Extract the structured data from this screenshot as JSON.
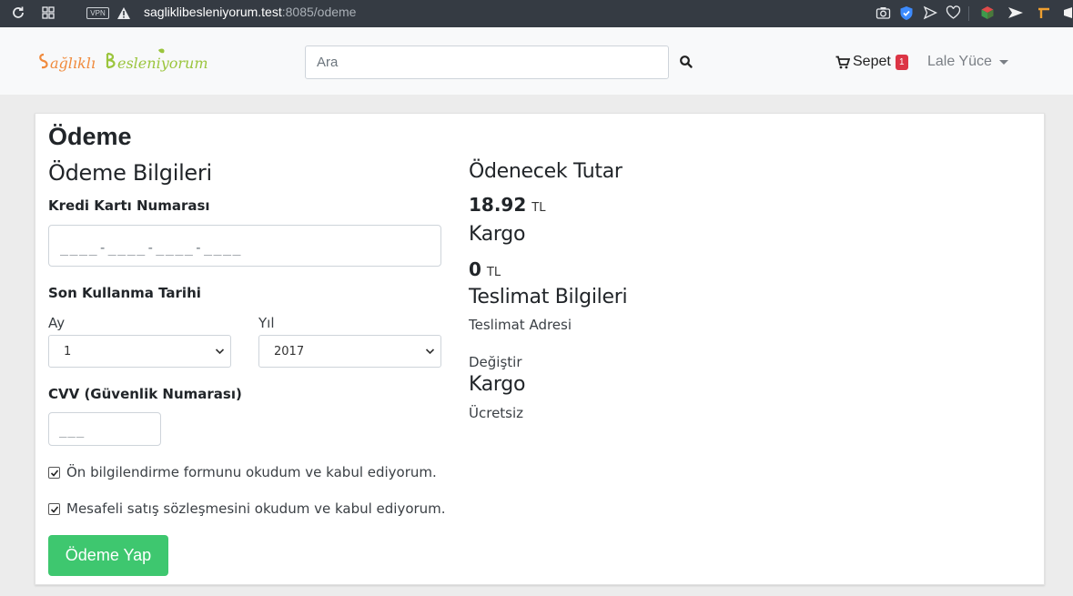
{
  "browser": {
    "url_host": "sagliklibesleniyorum.test",
    "url_path": ":8085/odeme",
    "vpn_label": "VPN"
  },
  "navbar": {
    "logo_text": "Sağlıklı Besleniyorum",
    "search_placeholder": "Ara",
    "cart_label": "Sepet",
    "cart_count": "1",
    "user_name": "Lale Yüce"
  },
  "page": {
    "title": "Ödeme",
    "payment_info_heading": "Ödeme Bilgileri",
    "card_number_label": "Kredi Kartı Numarası",
    "card_number_placeholder": "____-____-____-____",
    "expiry_label": "Son Kullanma Tarihi",
    "month_label": "Ay",
    "month_value": "1",
    "year_label": "Yıl",
    "year_value": "2017",
    "cvv_label": "CVV (Güvenlik Numarası)",
    "cvv_placeholder": "___",
    "checkbox_1": "Ön bilgilendirme formunu okudum ve kabul ediyorum.",
    "checkbox_2": "Mesafeli satış sözleşmesini okudum ve kabul ediyorum.",
    "pay_button": "Ödeme Yap"
  },
  "summary": {
    "amount_heading": "Ödenecek Tutar",
    "amount_value": "18.92",
    "currency": "TL",
    "shipping_heading": "Kargo",
    "shipping_value": "0",
    "delivery_heading": "Teslimat Bilgileri",
    "delivery_address": "Teslimat Adresi",
    "change_link": "Değiştir",
    "cargo_heading": "Kargo",
    "cargo_value": "Ücretsiz"
  },
  "colors": {
    "accent_green": "#3ec76f",
    "badge_red": "#dc3545",
    "logo_orange": "#f08a3c",
    "logo_green": "#9bc53d"
  }
}
